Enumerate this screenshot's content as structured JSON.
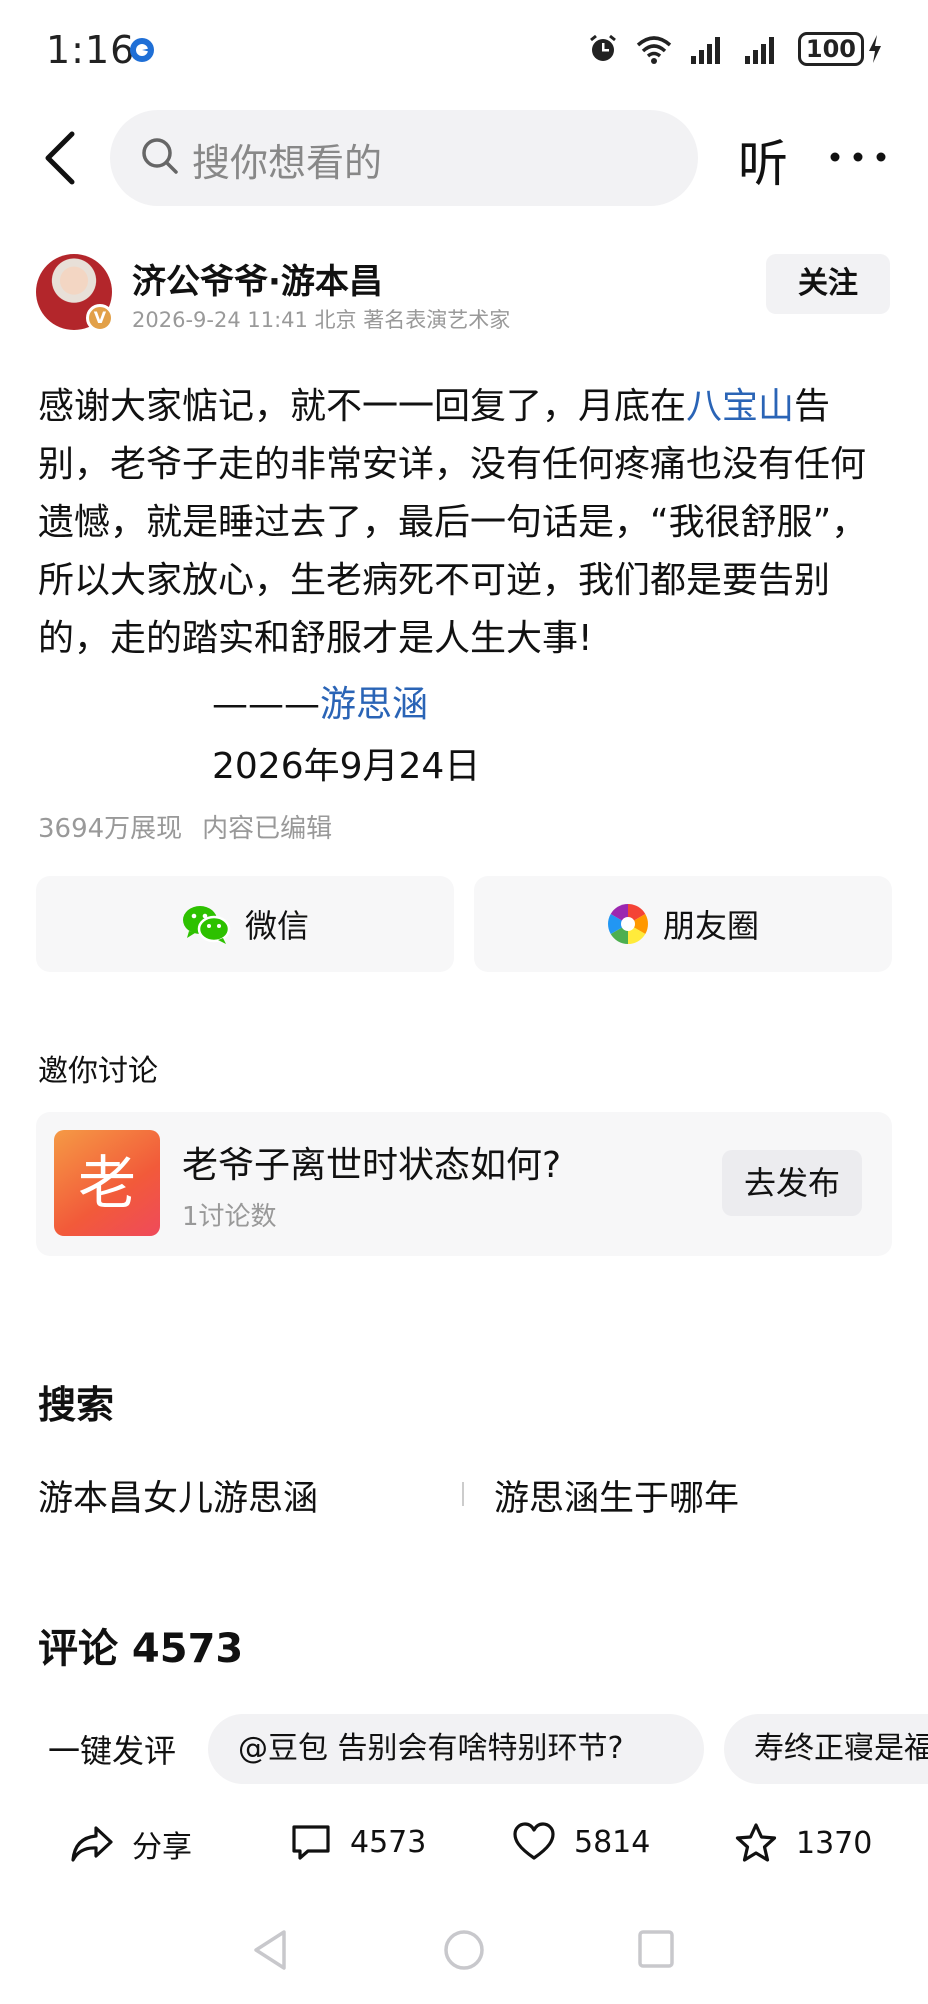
{
  "status_bar": {
    "time": "1:16",
    "battery": "100"
  },
  "search": {
    "placeholder": "搜你想看的",
    "listen_label": "听"
  },
  "author": {
    "name": "济公爷爷·游本昌",
    "badge": "V",
    "meta": "2026-9-24 11:41 北京 著名表演艺术家",
    "follow_label": "关注"
  },
  "post": {
    "text_1": "感谢大家惦记，就不一一回复了，月底在",
    "link_1": "八宝山",
    "text_2": "告别，老爷子走的非常安详，没有任何疼痛也没有任何遗憾，就是睡过去了，最后一句话是，“我很舒服”，所以大家放心，生老病死不可逆，我们都是要告别的，走的踏实和舒服才是人生大事!",
    "signature_dash": "———",
    "signature_name": "游思涵",
    "signature_date": "2026年9月24日",
    "views": "3694万展现",
    "edited": "内容已编辑"
  },
  "share": {
    "wechat_label": "微信",
    "moments_label": "朋友圈"
  },
  "discussion": {
    "title": "邀你讨论",
    "topic_thumb": "老",
    "topic_title": "老爷子离世时状态如何?",
    "topic_count": "1讨论数",
    "publish_label": "去发布"
  },
  "search_section": {
    "title": "搜索",
    "suggestions": [
      "游本昌女儿游思涵",
      "游思涵生于哪年"
    ]
  },
  "comments": {
    "title": "评论 4573",
    "quick_label": "一键发评",
    "chips": [
      "@豆包 告别会有啥特别环节?",
      "寿终正寝是福"
    ]
  },
  "actions": {
    "share_label": "分享",
    "comment_count": "4573",
    "like_count": "5814",
    "favorite_count": "1370"
  },
  "colors": {
    "link": "#2a64b6",
    "muted": "#999999",
    "card_bg": "#f7f7f8"
  }
}
